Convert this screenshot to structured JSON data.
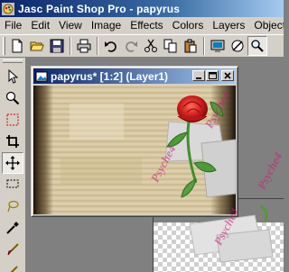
{
  "app": {
    "title": "Jasc Paint Shop Pro - papyrus"
  },
  "menu": {
    "items": [
      "File",
      "Edit",
      "View",
      "Image",
      "Effects",
      "Colors",
      "Layers",
      "Objects"
    ]
  },
  "toolbar": {
    "buttons": [
      "new-file",
      "open-file",
      "save-file",
      "print",
      "undo",
      "redo",
      "cut",
      "copy",
      "paste",
      "full-screen-preview",
      "overview",
      "zoom-preview"
    ]
  },
  "tools": [
    "arrow",
    "zoom",
    "selection",
    "crop",
    "mover",
    "freehand-selection",
    "dropper",
    "paint-brush",
    "clone-brush",
    "retouch"
  ],
  "document": {
    "title": "papyrus* [1:2] (Layer1)"
  },
  "watermark": {
    "text": "Psyche4"
  },
  "colors": {
    "title_bar": "#0a246a",
    "title_bar_end": "#a6caf0",
    "chrome": "#d4d0c8",
    "workspace": "#808080",
    "papyrus": "#d8c9a4",
    "rose": "#d42020",
    "leaf": "#3f8f2a"
  }
}
